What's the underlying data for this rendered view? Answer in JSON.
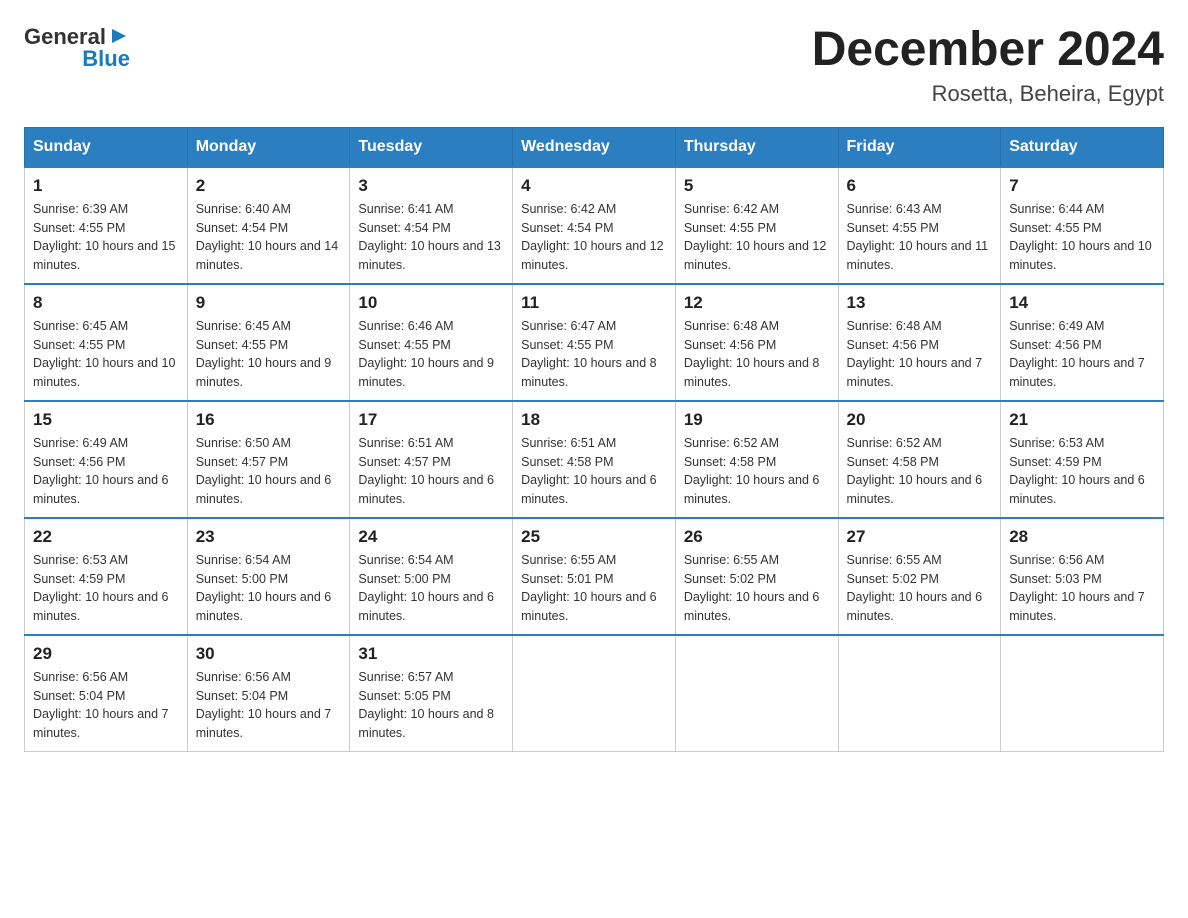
{
  "header": {
    "logo": {
      "text_general": "General",
      "text_blue": "Blue",
      "alt": "GeneralBlue logo"
    },
    "title": "December 2024",
    "location": "Rosetta, Beheira, Egypt"
  },
  "days_of_week": [
    "Sunday",
    "Monday",
    "Tuesday",
    "Wednesday",
    "Thursday",
    "Friday",
    "Saturday"
  ],
  "weeks": [
    [
      {
        "day": "1",
        "sunrise": "6:39 AM",
        "sunset": "4:55 PM",
        "daylight": "10 hours and 15 minutes."
      },
      {
        "day": "2",
        "sunrise": "6:40 AM",
        "sunset": "4:54 PM",
        "daylight": "10 hours and 14 minutes."
      },
      {
        "day": "3",
        "sunrise": "6:41 AM",
        "sunset": "4:54 PM",
        "daylight": "10 hours and 13 minutes."
      },
      {
        "day": "4",
        "sunrise": "6:42 AM",
        "sunset": "4:54 PM",
        "daylight": "10 hours and 12 minutes."
      },
      {
        "day": "5",
        "sunrise": "6:42 AM",
        "sunset": "4:55 PM",
        "daylight": "10 hours and 12 minutes."
      },
      {
        "day": "6",
        "sunrise": "6:43 AM",
        "sunset": "4:55 PM",
        "daylight": "10 hours and 11 minutes."
      },
      {
        "day": "7",
        "sunrise": "6:44 AM",
        "sunset": "4:55 PM",
        "daylight": "10 hours and 10 minutes."
      }
    ],
    [
      {
        "day": "8",
        "sunrise": "6:45 AM",
        "sunset": "4:55 PM",
        "daylight": "10 hours and 10 minutes."
      },
      {
        "day": "9",
        "sunrise": "6:45 AM",
        "sunset": "4:55 PM",
        "daylight": "10 hours and 9 minutes."
      },
      {
        "day": "10",
        "sunrise": "6:46 AM",
        "sunset": "4:55 PM",
        "daylight": "10 hours and 9 minutes."
      },
      {
        "day": "11",
        "sunrise": "6:47 AM",
        "sunset": "4:55 PM",
        "daylight": "10 hours and 8 minutes."
      },
      {
        "day": "12",
        "sunrise": "6:48 AM",
        "sunset": "4:56 PM",
        "daylight": "10 hours and 8 minutes."
      },
      {
        "day": "13",
        "sunrise": "6:48 AM",
        "sunset": "4:56 PM",
        "daylight": "10 hours and 7 minutes."
      },
      {
        "day": "14",
        "sunrise": "6:49 AM",
        "sunset": "4:56 PM",
        "daylight": "10 hours and 7 minutes."
      }
    ],
    [
      {
        "day": "15",
        "sunrise": "6:49 AM",
        "sunset": "4:56 PM",
        "daylight": "10 hours and 6 minutes."
      },
      {
        "day": "16",
        "sunrise": "6:50 AM",
        "sunset": "4:57 PM",
        "daylight": "10 hours and 6 minutes."
      },
      {
        "day": "17",
        "sunrise": "6:51 AM",
        "sunset": "4:57 PM",
        "daylight": "10 hours and 6 minutes."
      },
      {
        "day": "18",
        "sunrise": "6:51 AM",
        "sunset": "4:58 PM",
        "daylight": "10 hours and 6 minutes."
      },
      {
        "day": "19",
        "sunrise": "6:52 AM",
        "sunset": "4:58 PM",
        "daylight": "10 hours and 6 minutes."
      },
      {
        "day": "20",
        "sunrise": "6:52 AM",
        "sunset": "4:58 PM",
        "daylight": "10 hours and 6 minutes."
      },
      {
        "day": "21",
        "sunrise": "6:53 AM",
        "sunset": "4:59 PM",
        "daylight": "10 hours and 6 minutes."
      }
    ],
    [
      {
        "day": "22",
        "sunrise": "6:53 AM",
        "sunset": "4:59 PM",
        "daylight": "10 hours and 6 minutes."
      },
      {
        "day": "23",
        "sunrise": "6:54 AM",
        "sunset": "5:00 PM",
        "daylight": "10 hours and 6 minutes."
      },
      {
        "day": "24",
        "sunrise": "6:54 AM",
        "sunset": "5:00 PM",
        "daylight": "10 hours and 6 minutes."
      },
      {
        "day": "25",
        "sunrise": "6:55 AM",
        "sunset": "5:01 PM",
        "daylight": "10 hours and 6 minutes."
      },
      {
        "day": "26",
        "sunrise": "6:55 AM",
        "sunset": "5:02 PM",
        "daylight": "10 hours and 6 minutes."
      },
      {
        "day": "27",
        "sunrise": "6:55 AM",
        "sunset": "5:02 PM",
        "daylight": "10 hours and 6 minutes."
      },
      {
        "day": "28",
        "sunrise": "6:56 AM",
        "sunset": "5:03 PM",
        "daylight": "10 hours and 7 minutes."
      }
    ],
    [
      {
        "day": "29",
        "sunrise": "6:56 AM",
        "sunset": "5:04 PM",
        "daylight": "10 hours and 7 minutes."
      },
      {
        "day": "30",
        "sunrise": "6:56 AM",
        "sunset": "5:04 PM",
        "daylight": "10 hours and 7 minutes."
      },
      {
        "day": "31",
        "sunrise": "6:57 AM",
        "sunset": "5:05 PM",
        "daylight": "10 hours and 8 minutes."
      },
      null,
      null,
      null,
      null
    ]
  ],
  "labels": {
    "sunrise": "Sunrise:",
    "sunset": "Sunset:",
    "daylight": "Daylight:"
  }
}
